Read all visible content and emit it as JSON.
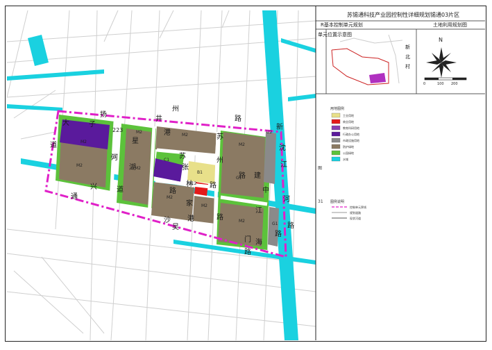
{
  "title": "苏锡通科技产业园控制性详细规划锡通03片区",
  "subtitle": "R基本控制单元规划",
  "map_name": "土地利用规划图",
  "inset_label_left": "单元位置示意图",
  "compass": {
    "north": "N",
    "ticks": [
      "0",
      "100",
      "200"
    ]
  },
  "inset_place_labels": [
    "新",
    "北",
    "村"
  ],
  "road_name_chars": [
    "扬",
    "子",
    "大",
    "道",
    "星",
    "湖",
    "路",
    "井",
    "州",
    "路",
    "苏",
    "州",
    "路",
    "兴",
    "通",
    "道",
    "张",
    "家",
    "港",
    "路",
    "海",
    "门",
    "路",
    "中",
    "江",
    "路",
    "新",
    "江",
    "河",
    "沈",
    "建",
    "路",
    "港",
    "沙",
    "河",
    "苏",
    "吴",
    "林",
    "路"
  ],
  "road_number": "223",
  "parcel_labels": {
    "mixed": [
      "M2",
      "M2",
      "M2",
      "M2",
      "M2",
      "M2",
      "M2",
      "M2",
      "M2"
    ],
    "green": [
      "G1",
      "G1",
      "G1",
      "G1",
      "G1",
      "G1"
    ],
    "commercial": "B1",
    "residential": "R1",
    "school": "S1",
    "gov": "C1",
    "utility": "U2",
    "block_s12": "S12"
  },
  "legend": {
    "title": "用地图例",
    "items": [
      "工业用地",
      "商业用地",
      "教育科研用地",
      "行政办公用地",
      "市政设施用地",
      "防护绿地",
      "公园绿地",
      "水域"
    ]
  },
  "boundary_legend": {
    "title": "图例说明",
    "items": [
      "控制单元界线",
      "规划道路",
      "现状河道"
    ]
  },
  "side_marks": [
    "图",
    "31"
  ],
  "colors": {
    "industrial": "#8b7a63",
    "green_park": "#5cc23b",
    "green_buffer": "#7fd25a",
    "water": "#1ad1e0",
    "purple": "#5a1a9c",
    "red": "#e41a1a",
    "yellow": "#e8e08a",
    "gray": "#8a8a8a",
    "boundary": "#e020c8",
    "road_line": "#c8c8c8"
  }
}
